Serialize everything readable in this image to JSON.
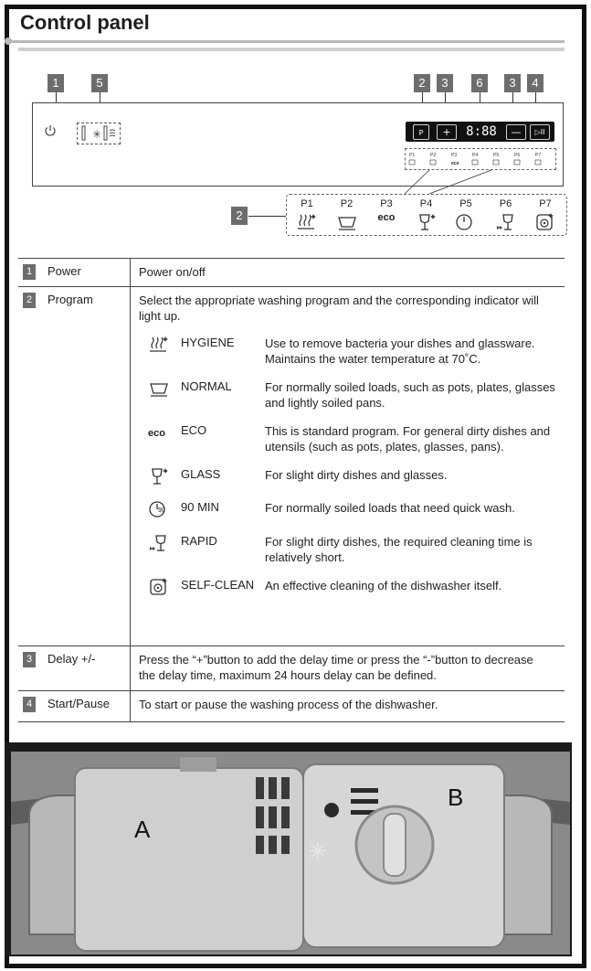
{
  "section_title": "Control panel",
  "callouts": {
    "power": "1",
    "delay_light": "5",
    "program_top": "2",
    "plus_top": "3",
    "display_top": "6",
    "minus_top": "3",
    "start_top": "4",
    "program_left": "2"
  },
  "panel": {
    "display_value": "8:88",
    "program_button": "P",
    "plus_symbol": "+",
    "minus_symbol": "—",
    "start_symbol": "▷II",
    "mini_labels": [
      "P1",
      "P2",
      "P3",
      "P4",
      "P5",
      "P6",
      "P7"
    ],
    "mini_eco": "eco"
  },
  "programs_strip": [
    {
      "code": "P1",
      "icon": "hygiene-icon"
    },
    {
      "code": "P2",
      "icon": "normal-icon"
    },
    {
      "code": "P3",
      "icon": "eco-text",
      "text": "eco"
    },
    {
      "code": "P4",
      "icon": "glass-icon"
    },
    {
      "code": "P5",
      "icon": "90min-icon"
    },
    {
      "code": "P6",
      "icon": "rapid-icon"
    },
    {
      "code": "P7",
      "icon": "selfclean-icon"
    }
  ],
  "table": {
    "rows": [
      {
        "num": "1",
        "label": "Power",
        "text": "Power on/off"
      },
      {
        "num": "2",
        "label": "Program",
        "text": "Select the appropriate washing program and the corresponding indicator will light up."
      },
      {
        "num": "3",
        "label": "Delay +/-",
        "text": "Press the “+”button to add the delay time or press the “-”button to decrease the delay time, maximum 24 hours delay can be defined."
      },
      {
        "num": "4",
        "label": "Start/Pause",
        "text": "To start or pause the washing process of the dishwasher."
      }
    ],
    "programs": [
      {
        "icon": "hygiene-icon",
        "name": "HYGIENE",
        "desc": "Use to remove bacteria your dishes and glassware. Maintains the water temperature at 70˚C."
      },
      {
        "icon": "normal-icon",
        "name": "NORMAL",
        "desc": "For normally soiled loads, such as pots, plates, glasses and lightly soiled pans."
      },
      {
        "icon": "eco-text",
        "glyph_text": "eco",
        "name": "ECO",
        "desc": "This is standard program. For general dirty dishes and utensils (such as pots, plates, glasses, pans)."
      },
      {
        "icon": "glass-icon",
        "name": "GLASS",
        "desc": "For slight dirty dishes and glasses."
      },
      {
        "icon": "90min-icon",
        "glyph_text": "90",
        "name": "90 MIN",
        "desc": "For normally soiled loads that need quick wash."
      },
      {
        "icon": "rapid-icon",
        "name": "RAPID",
        "desc": "For slight dirty dishes, the required cleaning time is relatively short."
      },
      {
        "icon": "selfclean-icon",
        "name": "SELF-CLEAN",
        "desc": "An effective cleaning of the dishwasher itself."
      }
    ]
  },
  "photo": {
    "label_a": "A",
    "label_b": "B"
  }
}
